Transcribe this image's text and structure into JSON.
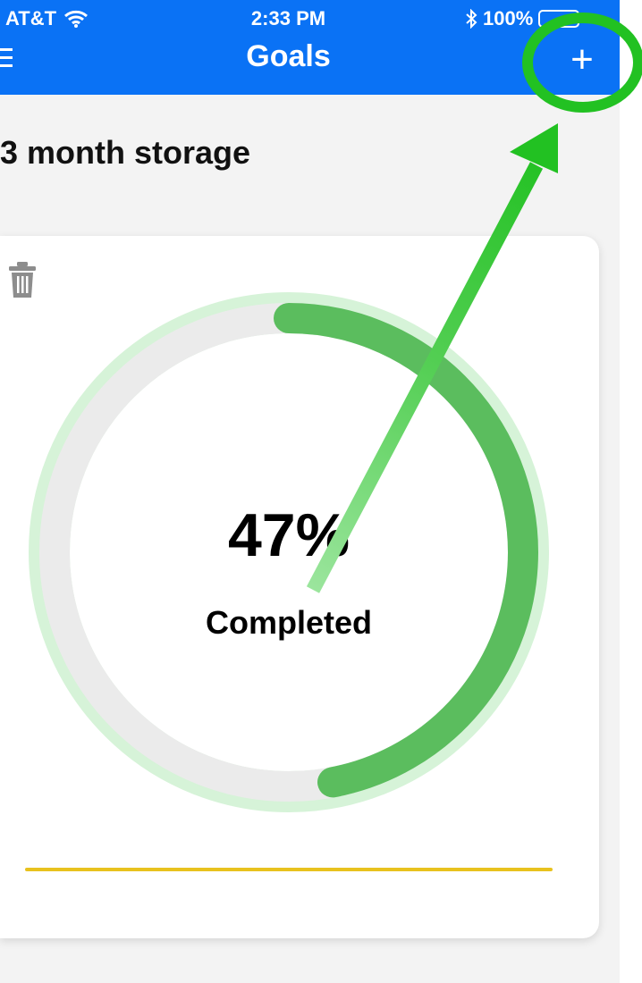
{
  "status_bar": {
    "carrier": "AT&T",
    "time": "2:33 PM",
    "battery": "100%",
    "wifi_icon": "wifi-icon",
    "bluetooth_icon": "bluetooth-icon"
  },
  "header": {
    "title": "Goals",
    "menu_icon": "menu-icon",
    "add_label": "+"
  },
  "goal": {
    "title": "3 month storage",
    "progress_percent_label": "47%",
    "progress_fraction": 0.47,
    "status_label": "Completed",
    "delete_icon": "trash-icon"
  },
  "colors": {
    "header_bg": "#0a72f5",
    "progress_fill": "#5bbd5e",
    "progress_track": "#ebebeb",
    "progress_halo": "#d6f3d8",
    "divider": "#e8c21e",
    "annotation": "#22c122"
  }
}
